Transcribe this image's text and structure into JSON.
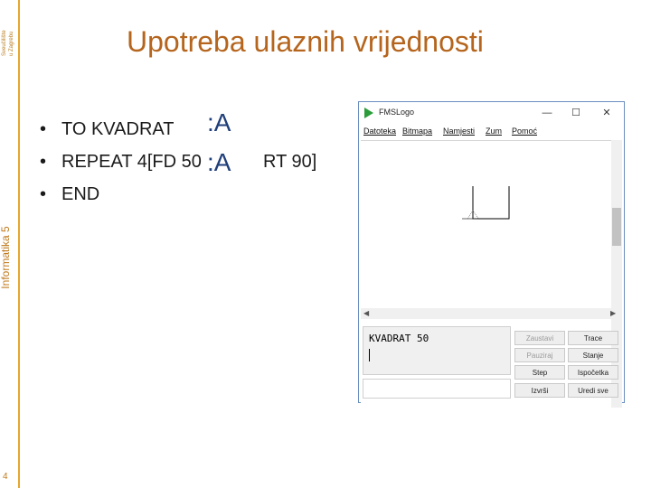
{
  "slide": {
    "corner_text": [
      "Sveučilište",
      "u Zagrebu"
    ],
    "side_label": "Informatika 5",
    "page_number": "4",
    "title": "Upotreba ulaznih vrijednosti",
    "bullets": [
      "TO KVADRAT",
      "REPEAT 4[FD 50",
      "END"
    ],
    "bullet_tail": "RT 90]",
    "param_a": ":A"
  },
  "window": {
    "title": "FMSLogo",
    "controls": {
      "minimize": "—",
      "maximize": "☐",
      "close": "✕"
    },
    "menu": [
      "Datoteka",
      "Bitmapa",
      "Namjesti",
      "Zum",
      "Pomoć"
    ],
    "command_output": "KVADRAT 50",
    "buttons": {
      "zaustavi": "Zaustavi",
      "trace": "Trace",
      "pauza": "Pauziraj",
      "stanje": "Stanje",
      "korak": "Step",
      "ispocetka": "Ispočetka",
      "izvrsi": "Izvrši",
      "uredi": "Uredi sve"
    }
  },
  "colors": {
    "accent": "#e8a530",
    "title": "#b5651d",
    "param": "#1f3f7a",
    "logo_icon": "#2a9d3a"
  }
}
